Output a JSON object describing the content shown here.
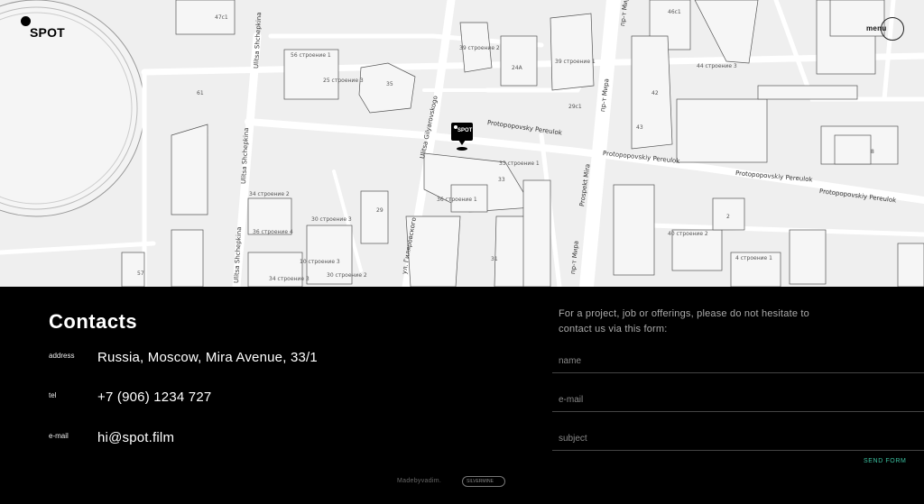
{
  "brand": {
    "logo_text": "SPOT"
  },
  "header": {
    "menu_label": "menu"
  },
  "map": {
    "pin_label": "SPOT",
    "streets": [
      "Protopopovsky Pereulok",
      "Protopopovskiy Pereulok",
      "Protopopovskiy Pereulok",
      "Protopopovskiy Pereulok",
      "Prospekt Mira",
      "пр-т Мира",
      "пр-т Мира",
      "пр-т Мира",
      "Ulitsa Shchepkina",
      "Ulitsa Shchepkina",
      "Ulitsa Shchepkina",
      "Ulitsa Gilyarovskogo",
      "ул. Гиляровского"
    ],
    "building_labels": [
      "47с1",
      "56 строение 1",
      "25 строение 3",
      "35",
      "39 строение 2",
      "24А",
      "39 строение 1",
      "29с1",
      "44 строение 3",
      "33 строение 1",
      "33",
      "36 строение 1",
      "30 строение 3",
      "34 строение 2",
      "36 строение 4",
      "10 строение 3",
      "30 строение 2",
      "29",
      "34 строение 3",
      "31",
      "40 строение 2",
      "4 строение 1",
      "42",
      "43",
      "61",
      "57",
      "2",
      "46с1",
      "8"
    ]
  },
  "contacts": {
    "title": "Contacts",
    "address_label": "address",
    "address_value": "Russia, Moscow, Mira Avenue, 33/1",
    "tel_label": "tel",
    "tel_value": "+7 (906) 1234 727",
    "email_label": "e-mail",
    "email_value": "hi@spot.film"
  },
  "form": {
    "intro": "For a project, job or offerings, please do not hesitate to contact us via this form:",
    "name_placeholder": "name",
    "email_placeholder": "e-mail",
    "subject_placeholder": "subject",
    "send_label": "SEND FORM"
  },
  "credits": {
    "madeby": "Madebyvadim.",
    "mark_text": "SILVERMINE"
  },
  "colors": {
    "map_bg": "#efefef",
    "footer_bg": "#000000",
    "accent": "#3bc0a0"
  }
}
